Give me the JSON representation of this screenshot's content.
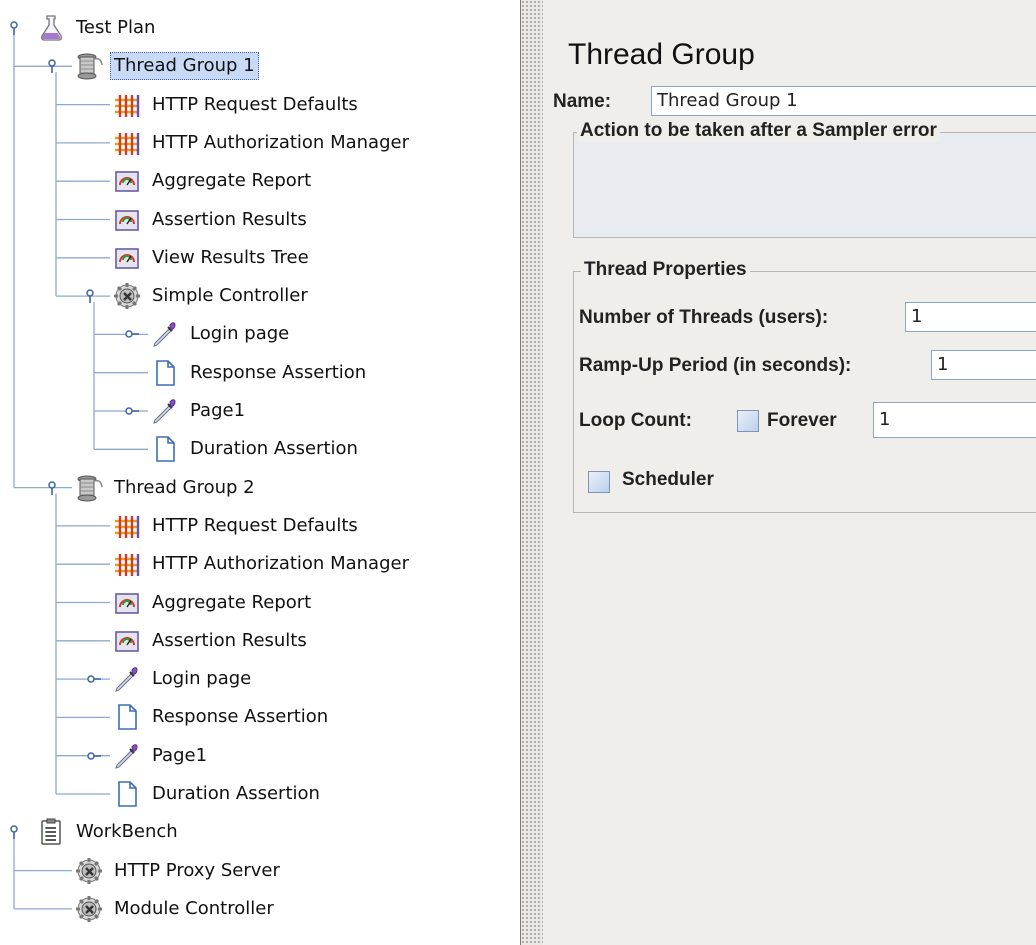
{
  "tree": {
    "nodes": [
      {
        "label": "Test Plan",
        "icon": "flask-icon",
        "level": 0,
        "toggle": "expanded"
      },
      {
        "label": "Thread Group 1",
        "icon": "spool-icon",
        "level": 1,
        "toggle": "expanded",
        "selected": true
      },
      {
        "label": "HTTP Request Defaults",
        "icon": "config-element-icon",
        "level": 2
      },
      {
        "label": "HTTP Authorization Manager",
        "icon": "config-element-icon",
        "level": 2
      },
      {
        "label": "Aggregate Report",
        "icon": "listener-gauge-icon",
        "level": 2
      },
      {
        "label": "Assertion Results",
        "icon": "listener-gauge-icon",
        "level": 2
      },
      {
        "label": "View Results Tree",
        "icon": "listener-gauge-icon",
        "level": 2
      },
      {
        "label": "Simple Controller",
        "icon": "controller-gear-icon",
        "level": 2,
        "toggle": "expanded"
      },
      {
        "label": "Login page",
        "icon": "sampler-pipette-icon",
        "level": 3,
        "toggle": "collapsed"
      },
      {
        "label": "Response Assertion",
        "icon": "assertion-document-icon",
        "level": 3
      },
      {
        "label": "Page1",
        "icon": "sampler-pipette-icon",
        "level": 3,
        "toggle": "collapsed"
      },
      {
        "label": "Duration Assertion",
        "icon": "assertion-document-icon",
        "level": 3
      },
      {
        "label": "Thread Group 2",
        "icon": "spool-icon",
        "level": 1,
        "toggle": "expanded"
      },
      {
        "label": "HTTP Request Defaults",
        "icon": "config-element-icon",
        "level": 2
      },
      {
        "label": "HTTP Authorization Manager",
        "icon": "config-element-icon",
        "level": 2
      },
      {
        "label": "Aggregate Report",
        "icon": "listener-gauge-icon",
        "level": 2
      },
      {
        "label": "Assertion Results",
        "icon": "listener-gauge-icon",
        "level": 2
      },
      {
        "label": "Login page",
        "icon": "sampler-pipette-icon",
        "level": 2,
        "toggle": "collapsed"
      },
      {
        "label": "Response Assertion",
        "icon": "assertion-document-icon",
        "level": 2
      },
      {
        "label": "Page1",
        "icon": "sampler-pipette-icon",
        "level": 2,
        "toggle": "collapsed"
      },
      {
        "label": "Duration Assertion",
        "icon": "assertion-document-icon",
        "level": 2
      },
      {
        "label": "WorkBench",
        "icon": "workbench-clipboard-icon",
        "level": 0,
        "toggle": "expanded"
      },
      {
        "label": "HTTP Proxy Server",
        "icon": "controller-gear-icon",
        "level": 1
      },
      {
        "label": "Module Controller",
        "icon": "controller-gear-icon",
        "level": 1
      }
    ]
  },
  "panel": {
    "title": "Thread Group",
    "name_label": "Name:",
    "name_value": "Thread Group 1",
    "sampler_error_legend": "Action to be taken after a Sampler error",
    "thread_properties_legend": "Thread Properties",
    "num_threads_label": "Number of Threads (users):",
    "num_threads_value": "1",
    "ramp_up_label": "Ramp-Up Period (in seconds):",
    "ramp_up_value": "1",
    "loop_count_label": "Loop Count:",
    "forever_label": "Forever",
    "forever_checked": false,
    "loop_count_value": "1",
    "scheduler_label": "Scheduler",
    "scheduler_checked": false
  },
  "colors": {
    "selection": "#c8daf5",
    "tree_lines": "#8fa8cf",
    "panel_bg": "#efeeea",
    "field_border": "#8ea4c5"
  }
}
